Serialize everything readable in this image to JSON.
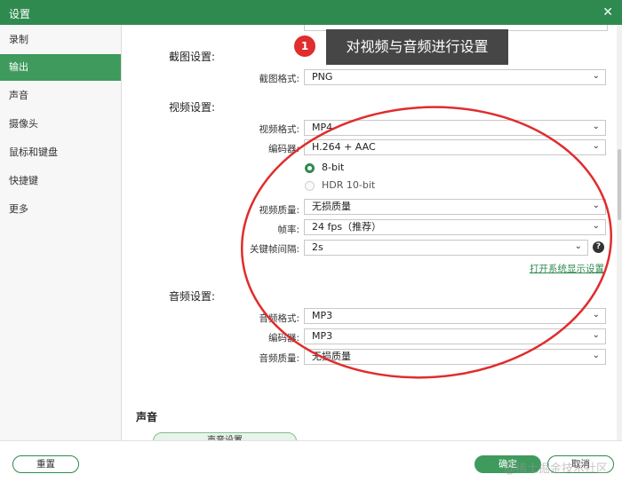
{
  "window": {
    "title": "设置",
    "close_glyph": "✕"
  },
  "sidebar": {
    "items": [
      {
        "label": "录制"
      },
      {
        "label": "输出"
      },
      {
        "label": "声音"
      },
      {
        "label": "摄像头"
      },
      {
        "label": "鼠标和键盘"
      },
      {
        "label": "快捷键"
      },
      {
        "label": "更多"
      }
    ],
    "active": "输出"
  },
  "screenshot_settings": {
    "title": "截图设置:",
    "format_label": "截图格式:",
    "format_value": "PNG"
  },
  "video_settings": {
    "title": "视频设置:",
    "format_label": "视频格式:",
    "format_value": "MP4",
    "encoder_label": "编码器:",
    "encoder_value": "H.264 + AAC",
    "bitdepth_options": [
      "8-bit",
      "HDR 10-bit"
    ],
    "quality_label": "视频质量:",
    "quality_value": "无损质量",
    "framerate_label": "帧率:",
    "framerate_value": "24 fps（推荐）",
    "keyframe_label": "关键帧间隔:",
    "keyframe_value": "2s",
    "system_display_link": "打开系统显示设置"
  },
  "audio_settings": {
    "title": "音频设置:",
    "format_label": "音频格式:",
    "format_value": "MP3",
    "encoder_label": "编码器:",
    "encoder_value": "MP3",
    "quality_label": "音频质量:",
    "quality_value": "无损质量"
  },
  "sound_section": {
    "title": "声音",
    "button_label": "声音设置"
  },
  "footer": {
    "reset_label": "重置",
    "ok_label": "确定",
    "cancel_label": "取消"
  },
  "annotation": {
    "number": "1",
    "text": "对视频与音频进行设置"
  },
  "watermark": "@稀土掘金技术社区",
  "icons": {
    "chevron": "chevron-down-icon",
    "help": "help-icon"
  },
  "colors": {
    "accent": "#2e8a4d",
    "titlebar": "#2f8a4f",
    "annotation_red": "#e02d2d"
  }
}
